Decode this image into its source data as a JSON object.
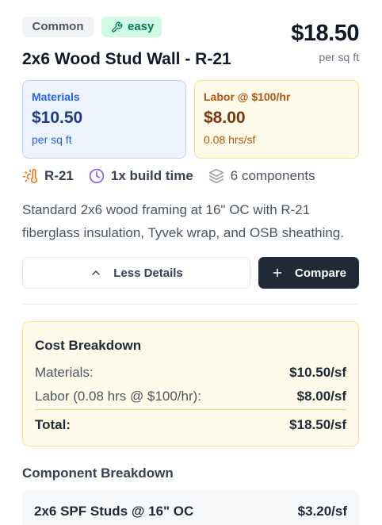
{
  "tags": {
    "common": "Common",
    "difficulty": "easy"
  },
  "price": {
    "amount": "$18.50",
    "unit": "per sq ft"
  },
  "title": "2x6 Wood Stud Wall - R-21",
  "materials": {
    "label": "Materials",
    "value": "$10.50",
    "unit": "per sq ft"
  },
  "labor": {
    "label": "Labor @ $100/hr",
    "value": "$8.00",
    "unit": "0.08 hrs/sf"
  },
  "stats": {
    "r_value": "R-21",
    "build_time": "1x build time",
    "components": "6 components"
  },
  "description": "Standard 2x6 wood framing at 16\" OC with R-21 fiberglass insulation, Tyvek wrap, and OSB sheathing.",
  "buttons": {
    "less_details": "Less Details",
    "compare": "Compare"
  },
  "cost_breakdown": {
    "title": "Cost Breakdown",
    "materials_label": "Materials:",
    "materials_value": "$10.50/sf",
    "labor_label": "Labor (0.08 hrs @ $100/hr):",
    "labor_value": "$8.00/sf",
    "total_label": "Total:",
    "total_value": "$18.50/sf"
  },
  "component_breakdown": {
    "title": "Component Breakdown",
    "items": [
      {
        "name": "2x6 SPF Studs @ 16\" OC",
        "cost": "$3.20/sf"
      }
    ]
  },
  "colors": {
    "accent_dark": "#1f2937",
    "materials_blue": "#2563eb",
    "labor_amber": "#b45309",
    "easy_green": "#047857"
  }
}
